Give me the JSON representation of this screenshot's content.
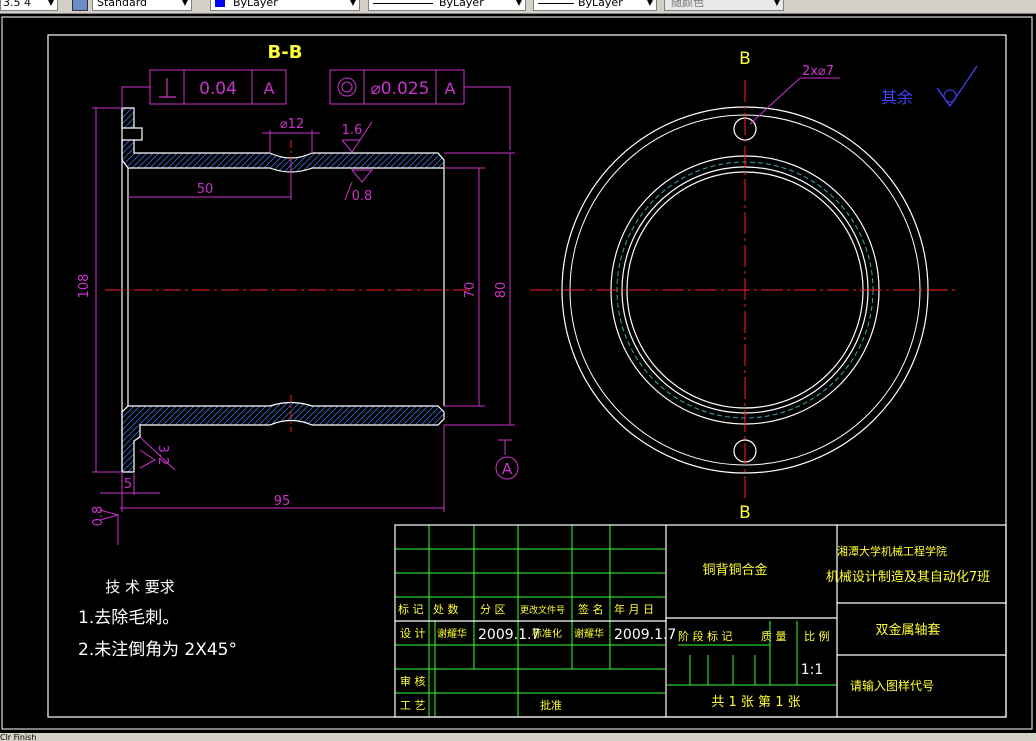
{
  "toolbar": {
    "scale_value": "3.5 4",
    "text_style": "Standard",
    "color_value": "ByLayer",
    "linetype_value": "ByLayer",
    "lineweight_value": "ByLayer",
    "plotstyle_value": "随颜色"
  },
  "statusbar": {
    "text": "Clr Finish"
  },
  "section": {
    "title": "B-B",
    "gdt1": {
      "tolerance": "0.04",
      "datum": "A"
    },
    "gdt2": {
      "tolerance": "⌀0.025",
      "datum": "A"
    },
    "dim_hole": "⌀12",
    "dim_50": "50",
    "dim_108": "108",
    "dim_70": "70",
    "dim_80": "80",
    "dim_5": "5",
    "dim_95": "95",
    "rough_16": "1.6",
    "rough_08a": "0.8",
    "rough_08b": "0.8",
    "rough_32": "3.2",
    "datum_label": "A"
  },
  "end_view": {
    "label_top": "B",
    "label_bottom": "B",
    "hole_dim": "2x⌀7",
    "remaining_text": "其余"
  },
  "tech_requirements": {
    "title": "技 术 要求",
    "line1": "1.去除毛刺。",
    "line2_a": "2.未注倒角",
    "line2_b": "为 2X45°"
  },
  "title_block": {
    "h_mark": "标 记",
    "h_count": "处 数",
    "h_zone": "分  区",
    "h_docno": "更改文件号",
    "h_sign": "签 名",
    "h_date": "年 月 日",
    "designer_label": "设 计",
    "designer_name": "谢耀华",
    "design_date": "2009.1.7",
    "std_label": "标准化",
    "std_name": "谢耀华",
    "std_date": "2009.1.7",
    "review_label": "审 核",
    "process_label": "工 艺",
    "approve_label": "批准",
    "material": "铜背铜合金",
    "school": "湘潭大学机械工程学院",
    "class_name": "机械设计制造及其自动化7班",
    "part_name": "双金属轴套",
    "stage_label": "阶 段 标 记",
    "weight_label": "质 量",
    "scale_label": "比 例",
    "scale_value": "1:1",
    "sheets": "共  1  张   第  1  张",
    "drawing_code": "请输入图样代号"
  },
  "colors": {
    "outline": "#ffffff",
    "dimension": "#cc33cc",
    "centerline": "#ff2020",
    "text_yellow": "#ffff33",
    "table_green": "#33ff33",
    "hidden": "#33aaaa",
    "label_blue": "#4444ff"
  }
}
